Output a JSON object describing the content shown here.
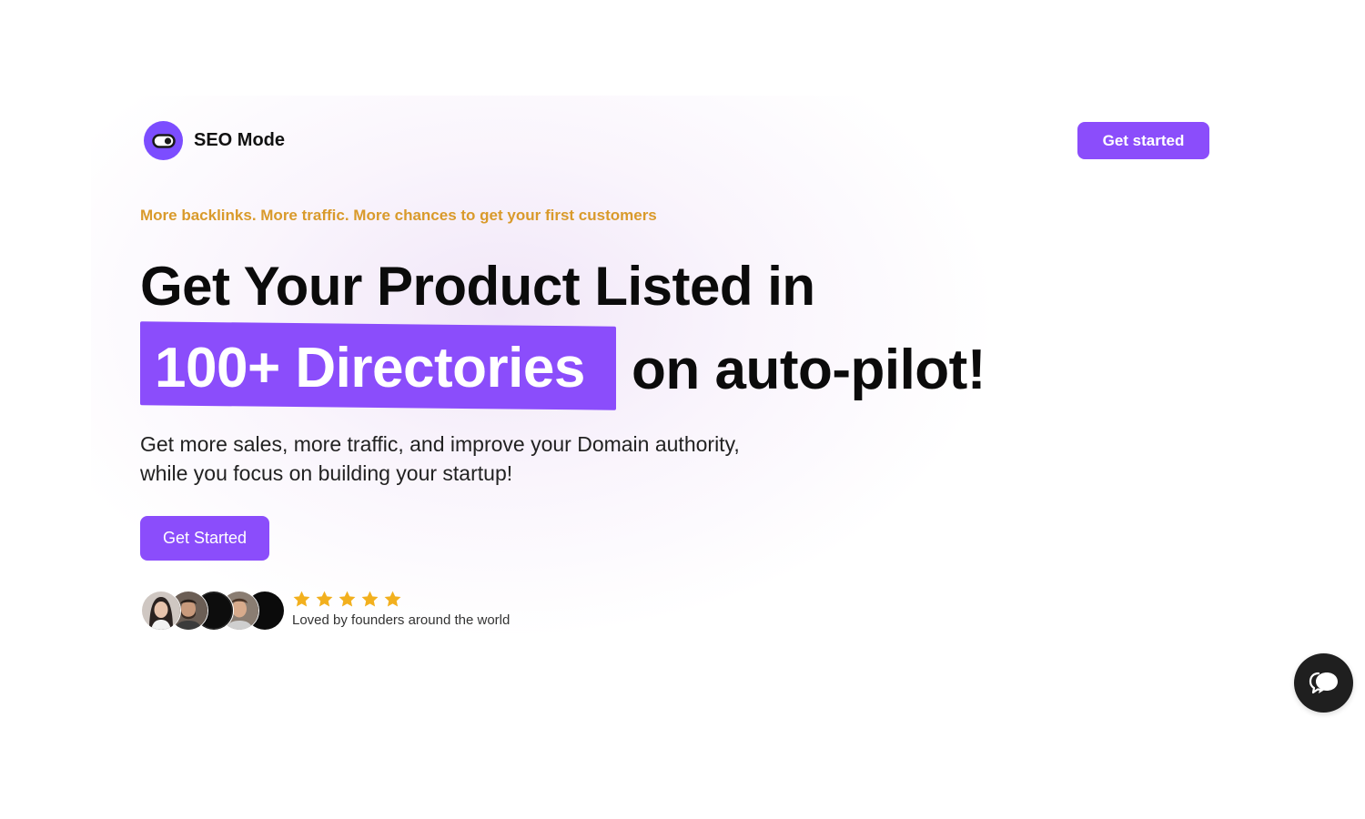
{
  "brand": {
    "name": "SEO Mode",
    "logo_icon": "toggle-icon",
    "accent_color": "#8b4dfb"
  },
  "nav": {
    "cta_label": "Get started"
  },
  "hero": {
    "tagline": "More backlinks. More traffic. More chances to get your first customers",
    "tagline_color": "#d99a2b",
    "headline_line1": "Get Your Product Listed in",
    "headline_highlight": "100+ Directories",
    "headline_line2_rest": "on auto-pilot!",
    "subtext_line1": "Get more sales, more traffic, and improve your Domain authority,",
    "subtext_line2": "while you focus on building your startup!",
    "cta_label": "Get Started"
  },
  "social_proof": {
    "avatars": [
      "avatar-woman",
      "avatar-man-beard",
      "avatar-dark",
      "avatar-man-smiling",
      "avatar-dark"
    ],
    "rating": 5,
    "rating_max": 5,
    "star_color": "#f2b01e",
    "caption": "Loved by founders around the world"
  },
  "chat": {
    "icon": "chat-bubbles-icon"
  }
}
